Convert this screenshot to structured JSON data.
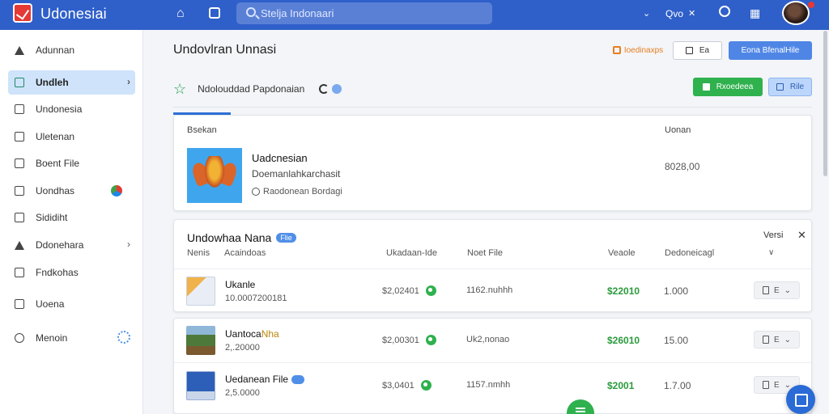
{
  "app": {
    "title": "Udonesiai"
  },
  "search": {
    "placeholder": "Stelja Indonaari"
  },
  "topbar": {
    "user_label": "Qvo"
  },
  "sidebar": {
    "items": [
      {
        "label": "Adunnan"
      },
      {
        "label": "Undleh"
      },
      {
        "label": "Undonesia"
      },
      {
        "label": "Uletenan"
      },
      {
        "label": "Boent File"
      },
      {
        "label": "Uondhas"
      },
      {
        "label": "Sididiht"
      },
      {
        "label": "Ddonehara"
      },
      {
        "label": "Fndkohas"
      },
      {
        "label": "Uoena"
      },
      {
        "label": "Menoin"
      }
    ]
  },
  "page": {
    "title": "Undovlran Unnasi",
    "subtitle": "Ndolouddad Papdonaian",
    "buttons": {
      "orange": "Ioedinaxps",
      "outline": "Ea",
      "primary": "Eona BfenalHile",
      "green": "Rxoedeea",
      "light": "Rile"
    }
  },
  "summary_card": {
    "header_left": "Bsekan",
    "header_right": "Uonan",
    "name": "Uadcnesian",
    "subtitle": "Doemanlahkarchasit",
    "meta": "Raodonean Bordagi",
    "value": "8028,00"
  },
  "list_card": {
    "title": "Undowhaa Nana",
    "pill": "Flie",
    "versi": "Versi",
    "columns": [
      "Nenis",
      "Acaindoas",
      "Ukadaan-Ide",
      "Noet File",
      "Veaole",
      "Dedoneicagl"
    ]
  },
  "rows": [
    {
      "name": "Ukanle",
      "sub": "10.0007200181",
      "amount": "$2,02401",
      "file": "1162.nuhhh",
      "price": "$22010",
      "qty": "1.000",
      "act": "E"
    },
    {
      "name_a": "Uantoca",
      "name_b": "Nha",
      "sub": "2,.20000",
      "amount": "$2,00301",
      "file": "Uk2,nonao",
      "price": "$26010",
      "qty": "15.00",
      "act": "E"
    },
    {
      "name": "Uedanean File",
      "sub": "2,5.0000",
      "amount": "$3,0401",
      "file": "1157.nmhh",
      "price": "$2001",
      "qty": "1.7.00",
      "act": "E"
    }
  ],
  "colors": {
    "accent": "#2f5fc9",
    "primary_button": "#4f86e6",
    "success": "#2fb14e",
    "price": "#2a9a3c"
  }
}
